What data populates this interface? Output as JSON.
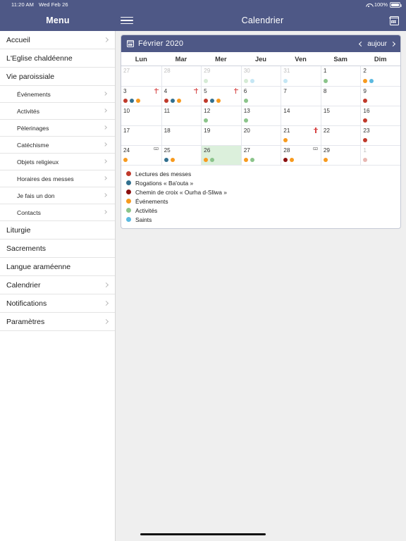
{
  "statusbar": {
    "time": "11:20 AM",
    "date": "Wed Feb 26",
    "battery_pct": "100%",
    "wifi_icon": "wifi-icon",
    "battery_icon": "battery-icon"
  },
  "sidebar": {
    "title": "Menu",
    "items": [
      {
        "label": "Accueil",
        "level": 1,
        "chevron": true
      },
      {
        "label": "L'Eglise chaldéenne",
        "level": 1,
        "chevron": false
      },
      {
        "label": "Vie paroissiale",
        "level": 1,
        "chevron": false
      },
      {
        "label": "Événements",
        "level": 2,
        "chevron": true
      },
      {
        "label": "Activités",
        "level": 2,
        "chevron": true
      },
      {
        "label": "Pèlerinages",
        "level": 2,
        "chevron": true
      },
      {
        "label": "Catéchisme",
        "level": 2,
        "chevron": true
      },
      {
        "label": "Objets religieux",
        "level": 2,
        "chevron": true
      },
      {
        "label": "Horaires des messes",
        "level": 2,
        "chevron": true
      },
      {
        "label": "Je fais un don",
        "level": 2,
        "chevron": true
      },
      {
        "label": "Contacts",
        "level": 2,
        "chevron": true
      },
      {
        "label": "Liturgie",
        "level": 1,
        "chevron": false
      },
      {
        "label": "Sacrements",
        "level": 1,
        "chevron": false
      },
      {
        "label": "Langue araméenne",
        "level": 1,
        "chevron": false
      },
      {
        "label": "Calendrier",
        "level": 1,
        "chevron": true
      },
      {
        "label": "Notifications",
        "level": 1,
        "chevron": true
      },
      {
        "label": "Paramètres",
        "level": 1,
        "chevron": true
      }
    ]
  },
  "navbar": {
    "menu_icon": "hamburger-icon",
    "title": "Calendrier",
    "calendar_icon": "calendar-icon"
  },
  "calendar": {
    "icon": "calendar-icon",
    "month_label": "Février 2020",
    "today_label": "aujour",
    "prev_icon": "chevron-left-icon",
    "next_icon": "chevron-right-icon",
    "weekdays": [
      "Lun",
      "Mar",
      "Mer",
      "Jeu",
      "Ven",
      "Sam",
      "Dim"
    ],
    "colors": {
      "lectures": "#c0392b",
      "rogations": "#31708f",
      "chemin_croix": "#8b0f0f",
      "evenements": "#f79a1e",
      "activites": "#8bc48b",
      "saints": "#5bb9e0",
      "header_bg": "#4e5886",
      "today_bg": "#dcf0dc"
    },
    "weeks": [
      [
        {
          "day": "27",
          "other": true,
          "dots": [],
          "icon": null
        },
        {
          "day": "28",
          "other": true,
          "dots": [],
          "icon": null
        },
        {
          "day": "29",
          "other": true,
          "dots": [
            "activites"
          ],
          "icon": null
        },
        {
          "day": "30",
          "other": true,
          "dots": [
            "activites",
            "saints"
          ],
          "icon": null
        },
        {
          "day": "31",
          "other": true,
          "dots": [
            "saints"
          ],
          "icon": null
        },
        {
          "day": "1",
          "other": false,
          "dots": [
            "activites"
          ],
          "icon": null
        },
        {
          "day": "2",
          "other": false,
          "dots": [
            "evenements",
            "saints"
          ],
          "icon": null
        }
      ],
      [
        {
          "day": "3",
          "other": false,
          "dots": [
            "lectures",
            "rogations",
            "evenements"
          ],
          "icon": "cross-icon"
        },
        {
          "day": "4",
          "other": false,
          "dots": [
            "lectures",
            "rogations",
            "evenements"
          ],
          "icon": "cross-icon"
        },
        {
          "day": "5",
          "other": false,
          "dots": [
            "lectures",
            "rogations",
            "evenements"
          ],
          "icon": "cross-icon"
        },
        {
          "day": "6",
          "other": false,
          "dots": [
            "activites"
          ],
          "icon": null
        },
        {
          "day": "7",
          "other": false,
          "dots": [],
          "icon": null
        },
        {
          "day": "8",
          "other": false,
          "dots": [],
          "icon": null
        },
        {
          "day": "9",
          "other": false,
          "dots": [
            "lectures"
          ],
          "icon": null
        }
      ],
      [
        {
          "day": "10",
          "other": false,
          "dots": [],
          "icon": null
        },
        {
          "day": "11",
          "other": false,
          "dots": [],
          "icon": null
        },
        {
          "day": "12",
          "other": false,
          "dots": [
            "activites"
          ],
          "icon": null
        },
        {
          "day": "13",
          "other": false,
          "dots": [
            "activites"
          ],
          "icon": null
        },
        {
          "day": "14",
          "other": false,
          "dots": [],
          "icon": null
        },
        {
          "day": "15",
          "other": false,
          "dots": [],
          "icon": null
        },
        {
          "day": "16",
          "other": false,
          "dots": [
            "lectures"
          ],
          "icon": null
        }
      ],
      [
        {
          "day": "17",
          "other": false,
          "dots": [],
          "icon": null
        },
        {
          "day": "18",
          "other": false,
          "dots": [],
          "icon": null
        },
        {
          "day": "19",
          "other": false,
          "dots": [],
          "icon": null
        },
        {
          "day": "20",
          "other": false,
          "dots": [],
          "icon": null
        },
        {
          "day": "21",
          "other": false,
          "dots": [
            "evenements"
          ],
          "icon": "cross-icon"
        },
        {
          "day": "22",
          "other": false,
          "dots": [],
          "icon": null
        },
        {
          "day": "23",
          "other": false,
          "dots": [
            "lectures"
          ],
          "icon": null
        }
      ],
      [
        {
          "day": "24",
          "other": false,
          "dots": [
            "evenements"
          ],
          "icon": "fast-icon"
        },
        {
          "day": "25",
          "other": false,
          "dots": [
            "rogations",
            "evenements"
          ],
          "icon": null
        },
        {
          "day": "26",
          "other": false,
          "today": true,
          "dots": [
            "evenements",
            "activites"
          ],
          "icon": null
        },
        {
          "day": "27",
          "other": false,
          "dots": [
            "evenements",
            "activites"
          ],
          "icon": null
        },
        {
          "day": "28",
          "other": false,
          "dots": [
            "chemin_croix",
            "evenements"
          ],
          "icon": "fast-icon"
        },
        {
          "day": "29",
          "other": false,
          "dots": [
            "evenements"
          ],
          "icon": null
        },
        {
          "day": "1",
          "other": true,
          "dots": [
            "lectures"
          ],
          "icon": null
        }
      ]
    ],
    "legend": [
      {
        "label": "Lectures des messes",
        "color_key": "lectures"
      },
      {
        "label": "Rogations « Ba'outa »",
        "color_key": "rogations"
      },
      {
        "label": "Chemin de croix « Ourha d-Sliwa »",
        "color_key": "chemin_croix"
      },
      {
        "label": "Événements",
        "color_key": "evenements"
      },
      {
        "label": "Activités",
        "color_key": "activites"
      },
      {
        "label": "Saints",
        "color_key": "saints"
      }
    ]
  }
}
